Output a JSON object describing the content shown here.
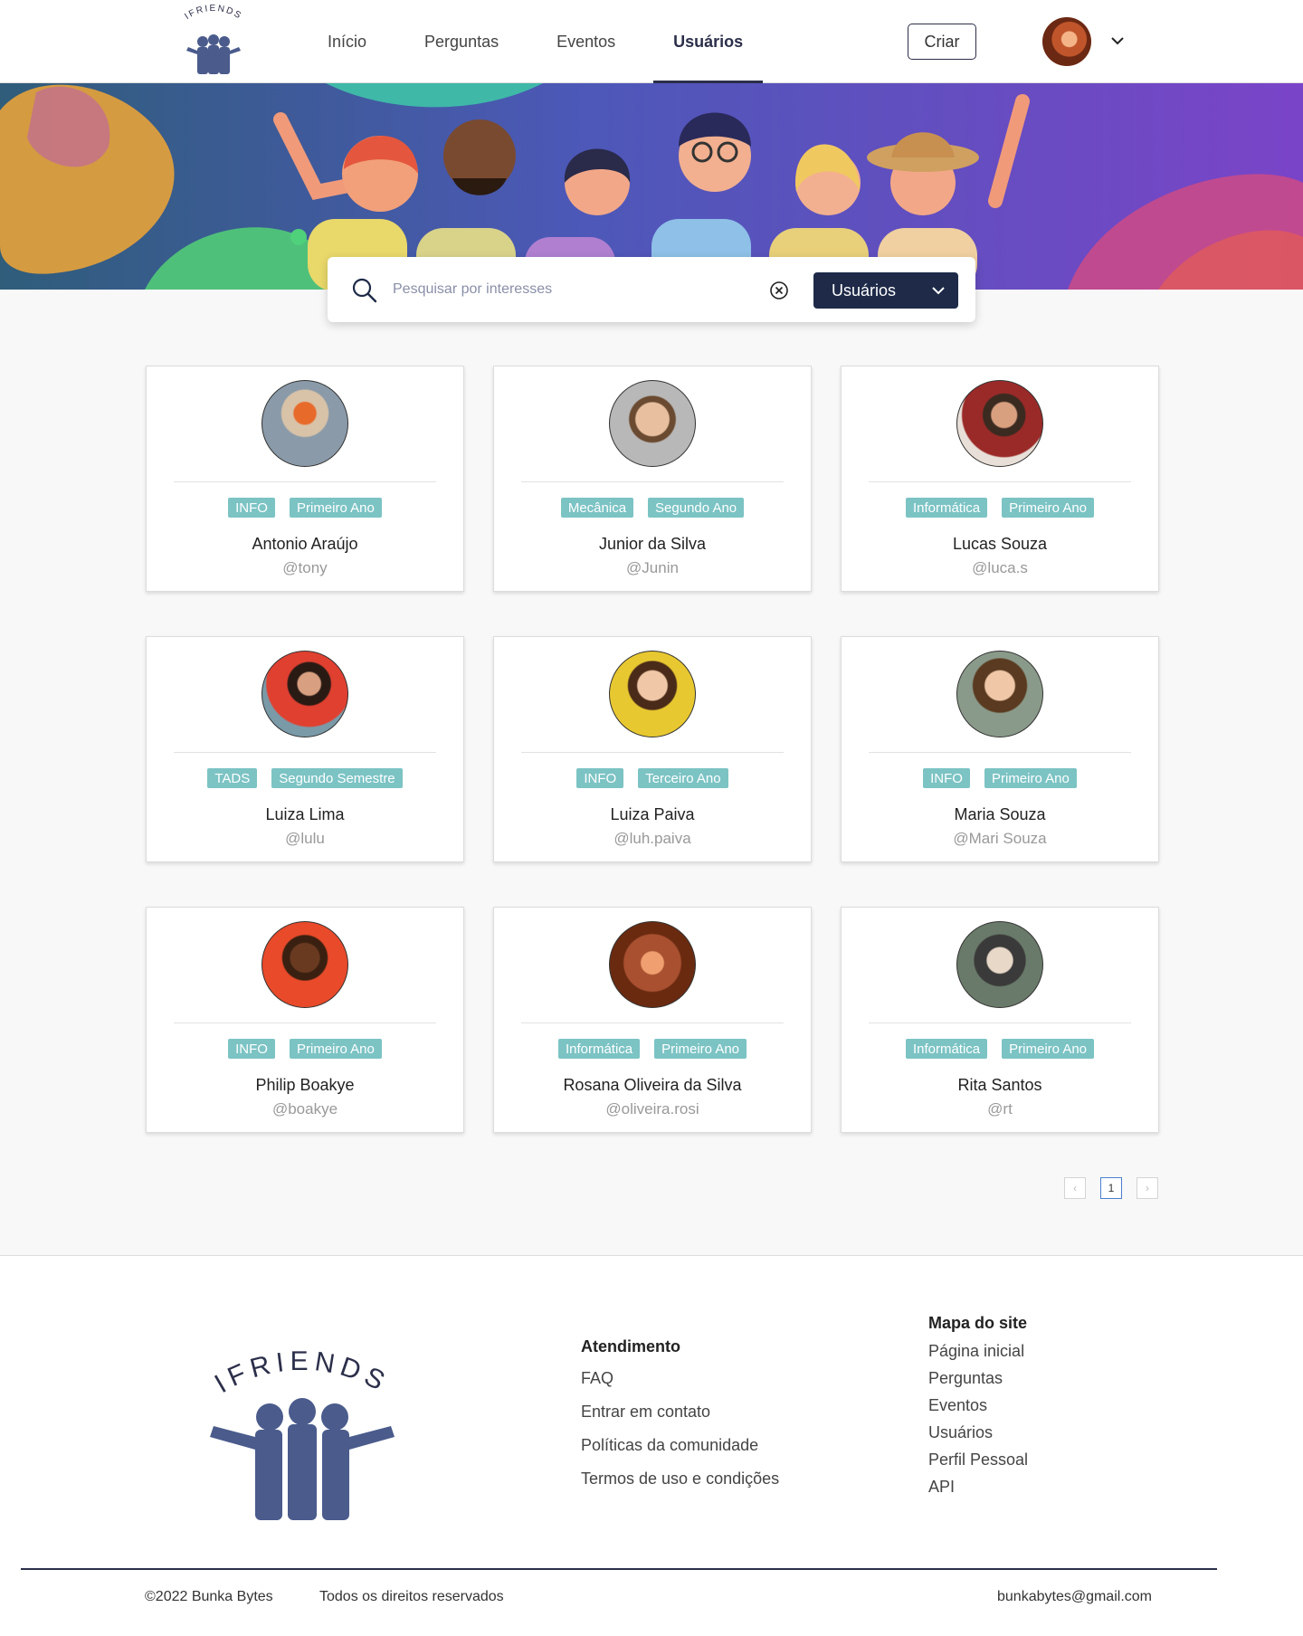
{
  "header": {
    "nav": [
      "Início",
      "Perguntas",
      "Eventos",
      "Usuários"
    ],
    "active_nav": "Usuários",
    "create_label": "Criar",
    "logo_text": "IFRIENDS"
  },
  "search": {
    "placeholder": "Pesquisar por interesses",
    "filter_label": "Usuários"
  },
  "users": [
    {
      "tags": [
        "INFO",
        "Primeiro Ano"
      ],
      "name": "Antonio Araújo",
      "handle": "@tony"
    },
    {
      "tags": [
        "Mecânica",
        "Segundo Ano"
      ],
      "name": "Junior da Silva",
      "handle": "@Junin"
    },
    {
      "tags": [
        "Informática",
        "Primeiro Ano"
      ],
      "name": "Lucas Souza",
      "handle": "@luca.s"
    },
    {
      "tags": [
        "TADS",
        "Segundo Semestre"
      ],
      "name": "Luiza Lima",
      "handle": "@lulu"
    },
    {
      "tags": [
        "INFO",
        "Terceiro Ano"
      ],
      "name": "Luiza Paiva",
      "handle": "@luh.paiva"
    },
    {
      "tags": [
        "INFO",
        "Primeiro Ano"
      ],
      "name": "Maria Souza",
      "handle": "@Mari Souza"
    },
    {
      "tags": [
        "INFO",
        "Primeiro Ano"
      ],
      "name": "Philip Boakye",
      "handle": "@boakye"
    },
    {
      "tags": [
        "Informática",
        "Primeiro Ano"
      ],
      "name": "Rosana Oliveira da Silva",
      "handle": "@oliveira.rosi"
    },
    {
      "tags": [
        "Informática",
        "Primeiro Ano"
      ],
      "name": "Rita Santos",
      "handle": "@rt"
    }
  ],
  "pagination": {
    "current": "1"
  },
  "footer": {
    "logo_text": "IFRIENDS",
    "atendimento": {
      "title": "Atendimento",
      "links": [
        "FAQ",
        "Entrar em contato",
        "Políticas da comunidade",
        "Termos de uso e condições"
      ]
    },
    "mapa": {
      "title": "Mapa do site",
      "links": [
        "Página inicial",
        "Perguntas",
        "Eventos",
        "Usuários",
        "Perfil Pessoal",
        "API"
      ]
    },
    "copyright": "©2022 Bunka Bytes",
    "rights": "Todos os direitos reservados",
    "email": "bunkabytes@gmail.com"
  },
  "colors": {
    "primary": "#1e2a48",
    "tag": "#7cc3c4",
    "logo": "#4a5b8c"
  }
}
